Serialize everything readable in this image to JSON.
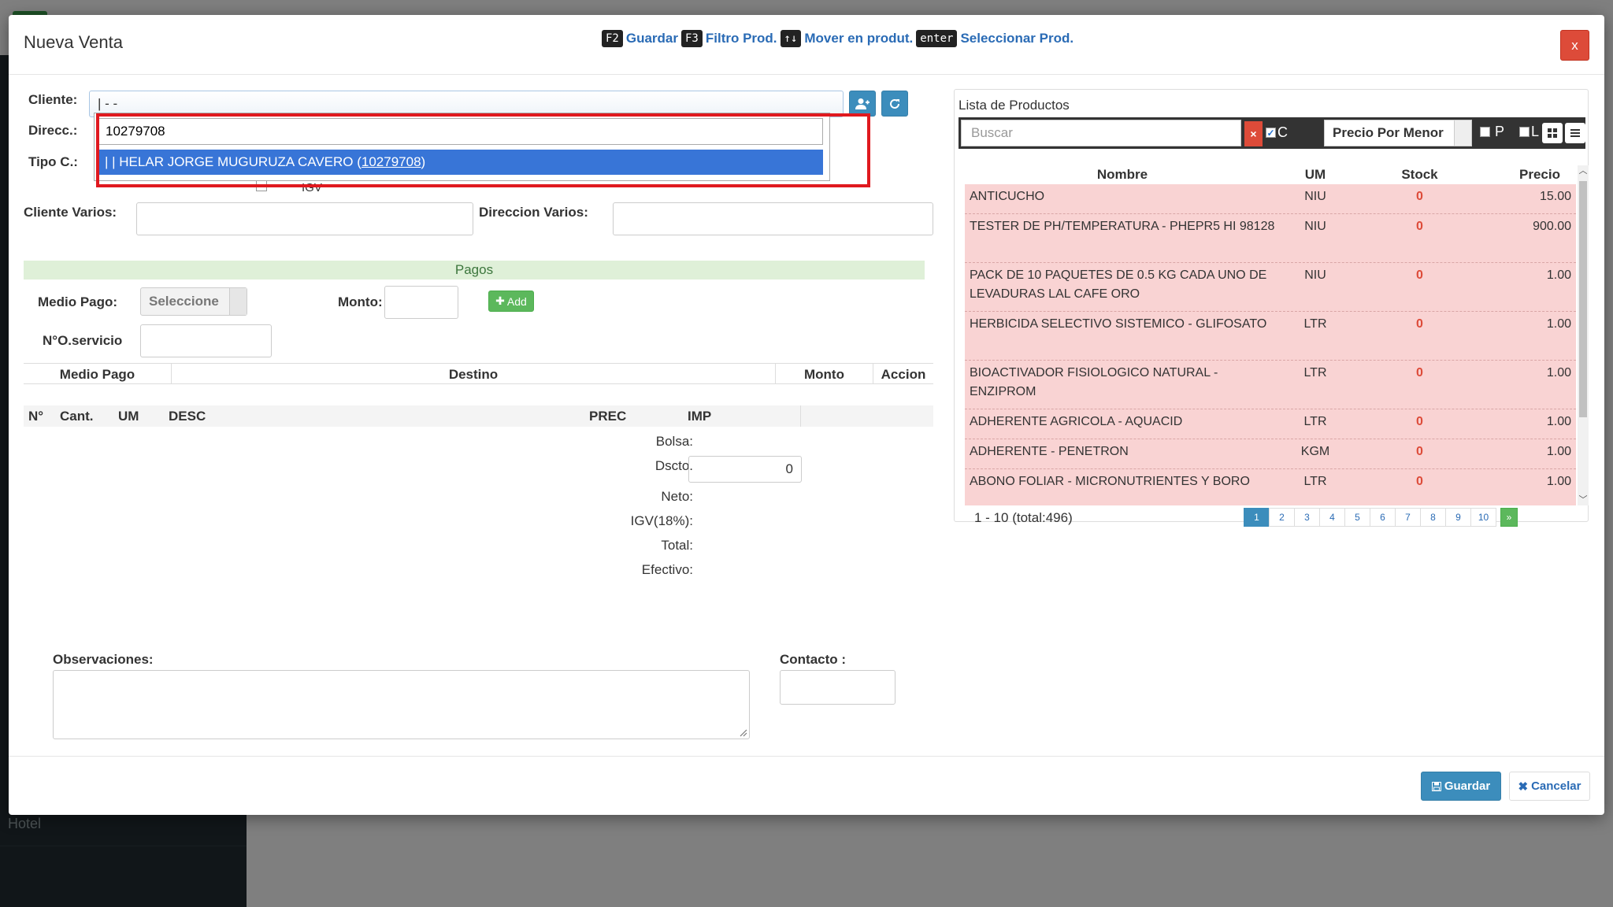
{
  "background": {
    "sidebar_item": "Hotel"
  },
  "modal": {
    "title": "Nueva Venta",
    "close_label": "x",
    "shortcuts": [
      {
        "key": "F2",
        "label": "Guardar"
      },
      {
        "key": "F3",
        "label": "Filtro Prod."
      },
      {
        "key": "↑↓",
        "label": "Mover en produt."
      },
      {
        "key": "enter",
        "label": "Seleccionar Prod."
      }
    ]
  },
  "form": {
    "cliente_label": "Cliente:",
    "cliente_value": "| - -",
    "direcc_label": "Direcc.:",
    "tipo_label": "Tipo C.:",
    "igv_text": "IGV",
    "cliente_varios_label": "Cliente Varios:",
    "direccion_varios_label": "Direccion Varios:",
    "search_value": "10279708",
    "option_prefix": "| | HELAR JORGE MUGURUZA CAVERO (",
    "option_code": "10279708",
    "option_suffix": ")"
  },
  "pagos": {
    "section_title": "Pagos",
    "medio_pago_label": "Medio Pago:",
    "medio_pago_value": "Seleccione",
    "monto_label": "Monto:",
    "add_label": "Add",
    "servicio_label": "N°O.servicio",
    "table_headers": [
      "Medio Pago",
      "Destino",
      "Monto",
      "Accion"
    ]
  },
  "items_table": {
    "headers": [
      "N°",
      "Cant.",
      "UM",
      "DESC",
      "PREC",
      "IMP"
    ]
  },
  "totals": {
    "bolsa": "Bolsa:",
    "dscto": "Dscto.",
    "dscto_value": "0",
    "neto": "Neto:",
    "igv": "IGV(18%):",
    "total": "Total:",
    "efectivo": "Efectivo:"
  },
  "notes": {
    "observaciones_label": "Observaciones:",
    "contacto_label": "Contacto :"
  },
  "footer": {
    "guardar": "Guardar",
    "cancelar": "Cancelar"
  },
  "products": {
    "title": "Lista de Productos",
    "search_placeholder": "Buscar",
    "clear_label": "×",
    "c_label": "C",
    "price_select": "Precio Por Menor",
    "p_label": "P",
    "l_label": "L",
    "headers": [
      "Nombre",
      "UM",
      "Stock",
      "Precio"
    ],
    "rows": [
      {
        "nombre": "ANTICUCHO",
        "um": "NIU",
        "stock": "0",
        "precio": "15.00"
      },
      {
        "nombre": "TESTER DE PH/TEMPERATURA - PHEPR5 HI 98128",
        "um": "NIU",
        "stock": "0",
        "precio": "900.00"
      },
      {
        "nombre": "PACK DE 10 PAQUETES DE 0.5 KG CADA UNO DE LEVADURAS LAL CAFE ORO",
        "um": "NIU",
        "stock": "0",
        "precio": "1.00"
      },
      {
        "nombre": "HERBICIDA SELECTIVO SISTEMICO - GLIFOSATO",
        "um": "LTR",
        "stock": "0",
        "precio": "1.00"
      },
      {
        "nombre": "BIOACTIVADOR FISIOLOGICO NATURAL - ENZIPROM",
        "um": "LTR",
        "stock": "0",
        "precio": "1.00"
      },
      {
        "nombre": "ADHERENTE AGRICOLA - AQUACID",
        "um": "LTR",
        "stock": "0",
        "precio": "1.00"
      },
      {
        "nombre": "ADHERENTE - PENETRON",
        "um": "KGM",
        "stock": "0",
        "precio": "1.00"
      },
      {
        "nombre": "ABONO FOLIAR - MICRONUTRIENTES Y BORO",
        "um": "LTR",
        "stock": "0",
        "precio": "1.00"
      }
    ],
    "count_text": "1 - 10 (total:496)",
    "pages": [
      "1",
      "2",
      "3",
      "4",
      "5",
      "6",
      "7",
      "8",
      "9",
      "10"
    ],
    "active_page": "1",
    "next_label": "»"
  }
}
